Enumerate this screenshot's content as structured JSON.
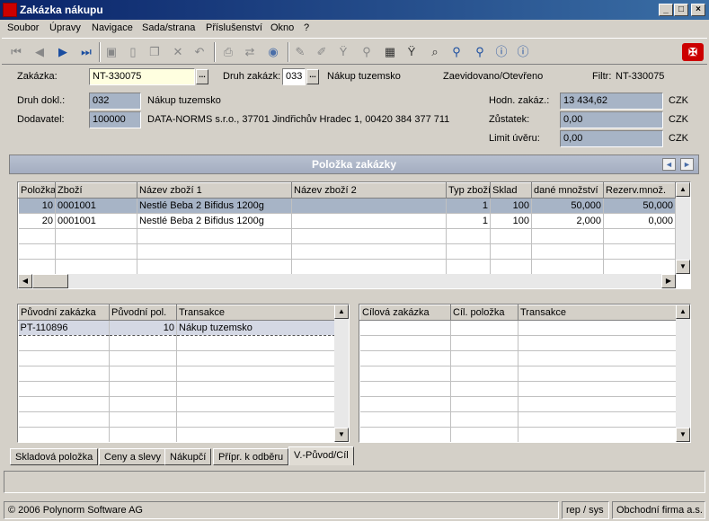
{
  "window": {
    "title": "Zakázka nákupu",
    "min": "_",
    "max": "□",
    "close": "×"
  },
  "menu": [
    "Soubor",
    "Úpravy",
    "Navigace",
    "Sada/strana",
    "Příslušenství",
    "Okno",
    "?"
  ],
  "header": {
    "zakazka_label": "Zakázka:",
    "zakazka_value": "NT-330075",
    "dots": "...",
    "druh_zakazk_label": "Druh zakázk:",
    "druh_zakazk_value": "033",
    "druh_zakazk_name": "Nákup tuzemsko",
    "status": "Zaevidovano/Otevřeno",
    "filter_label": "Filtr:",
    "filter_value": "NT-330075",
    "druh_dokl_label": "Druh dokl.:",
    "druh_dokl_value": "032",
    "druh_dokl_name": "Nákup tuzemsko",
    "dodavatel_label": "Dodavatel:",
    "dodavatel_value": "100000",
    "dodavatel_name": "DATA-NORMS s.r.o., 37701 Jindřichův Hradec 1, 00420 384 377 711",
    "hodn_label": "Hodn. zakáz.:",
    "hodn_value": "13 434,62",
    "hodn_cur": "CZK",
    "zustatek_label": "Zůstatek:",
    "zustatek_value": "0,00",
    "zustatek_cur": "CZK",
    "limit_label": "Limit úvěru:",
    "limit_value": "0,00",
    "limit_cur": "CZK"
  },
  "section": {
    "title": "Položka zakázky",
    "prev": "◄",
    "next": "►"
  },
  "items_table": {
    "headers": [
      "Položka",
      "Zboží",
      "Název zboží 1",
      "Název zboží 2",
      "Typ zboží",
      "Sklad",
      "dané množství",
      "Rezerv.množ."
    ],
    "rows": [
      [
        "10",
        "0001001",
        "Nestlé Beba 2 Bifidus 1200g",
        "",
        "1",
        "100",
        "50,000",
        "50,000"
      ],
      [
        "20",
        "0001001",
        "Nestlé Beba 2 Bifidus 1200g",
        "",
        "1",
        "100",
        "2,000",
        "0,000"
      ]
    ]
  },
  "origin_table": {
    "headers": [
      "Původní zakázka",
      "Původní pol.",
      "Transakce"
    ],
    "rows": [
      [
        "PT-110896",
        "10",
        "Nákup tuzemsko"
      ]
    ]
  },
  "target_table": {
    "headers": [
      "Cílová zakázka",
      "Cíl. položka",
      "Transakce"
    ],
    "rows": []
  },
  "tabs": [
    "Skladová položka",
    "Ceny a slevy",
    "Nákupčí",
    "Přípr. k odběru",
    "V.-Původ/Cíl"
  ],
  "status": {
    "copyright": "© 2006 Polynorm Software AG",
    "user": "rep / sys",
    "company": "Obchodní firma a.s."
  }
}
